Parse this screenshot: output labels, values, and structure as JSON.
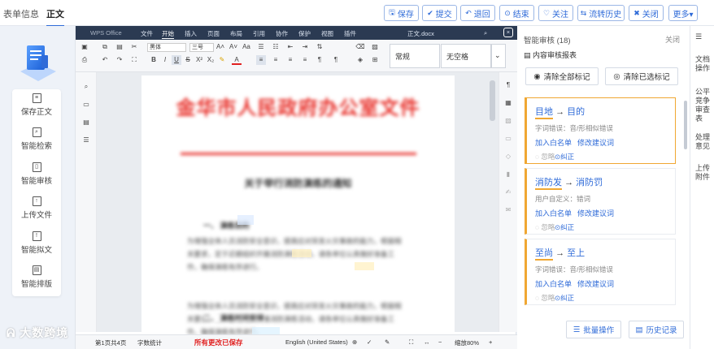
{
  "header": {
    "tabs": [
      {
        "label": "表单信息"
      },
      {
        "label": "正文"
      }
    ],
    "actions": [
      {
        "label": "保存",
        "icon": "save-icon",
        "glyph": "🖫"
      },
      {
        "label": "提交",
        "icon": "check-icon",
        "glyph": "✔"
      },
      {
        "label": "退回",
        "icon": "return-icon",
        "glyph": "↶"
      },
      {
        "label": "结束",
        "icon": "stop-icon",
        "glyph": "⊙"
      },
      {
        "label": "关注",
        "icon": "heart-icon",
        "glyph": "♡"
      },
      {
        "label": "流转历史",
        "icon": "flow-icon",
        "glyph": "⇆"
      },
      {
        "label": "关闭",
        "icon": "close-icon",
        "glyph": "✖"
      },
      {
        "label": "更多▾",
        "icon": "more-icon",
        "glyph": ""
      }
    ]
  },
  "sidebar": {
    "items": [
      {
        "label": "保存正文"
      },
      {
        "label": "智能检索"
      },
      {
        "label": "智能审核"
      },
      {
        "label": "上传文件"
      },
      {
        "label": "智能拟文"
      },
      {
        "label": "智能排版"
      }
    ]
  },
  "editor": {
    "brand": "WPS Office",
    "menus": [
      "文件",
      "开始",
      "插入",
      "页面",
      "布局",
      "引用",
      "协作",
      "保护",
      "视图",
      "插件"
    ],
    "doc_title": "正文.docx",
    "font_name": "黑体",
    "font_size": "三号",
    "style_normal": "常规",
    "style_nospace": "无空格",
    "page": {
      "heading": "金华市人民政府办公室文件",
      "subtitle": "关于举行消防演练的通知",
      "section1": "一、 演练目的",
      "section2": "二、 演练时间安排",
      "para": "为增强全体人员消防安全意识，提高应对突发火灾事故的能力，根据相关要求，定于近期组织开展消防演练活动，请各单位认真做好准备工作，确保演练有序进行。"
    },
    "status": {
      "page_info": "第1页共4页",
      "word_count": "字数统计",
      "save_state": "所有更改已保存",
      "language": "English (United States)",
      "zoom": "缩放80%"
    }
  },
  "review": {
    "title": "智能审核 (18)",
    "close": "关闭",
    "report": "内容审核报表",
    "clear_all": "清除全部标记",
    "clear_selected": "清除已选标记",
    "arrow": "→",
    "items": [
      {
        "original": "目地",
        "suggest": "目的",
        "type": "字词错误：音/形相似错误"
      },
      {
        "original": "消防发",
        "suggest": "消防罚",
        "type": "用户自定义：错词"
      },
      {
        "original": "至尚",
        "suggest": "至上",
        "type": "字词错误：音/形相似错误"
      }
    ],
    "add_whitelist": "加入白名单",
    "modify_suggest": "修改建议词",
    "ignore": "忽略",
    "fix": "纠正",
    "batch": "批量操作",
    "history": "历史记录"
  },
  "rail": {
    "items": [
      {
        "label": "文档操作"
      },
      {
        "label": "公平竞争审查表"
      },
      {
        "label": "处理意见"
      },
      {
        "label": "上传附件"
      }
    ]
  },
  "watermark": "大数跨境"
}
